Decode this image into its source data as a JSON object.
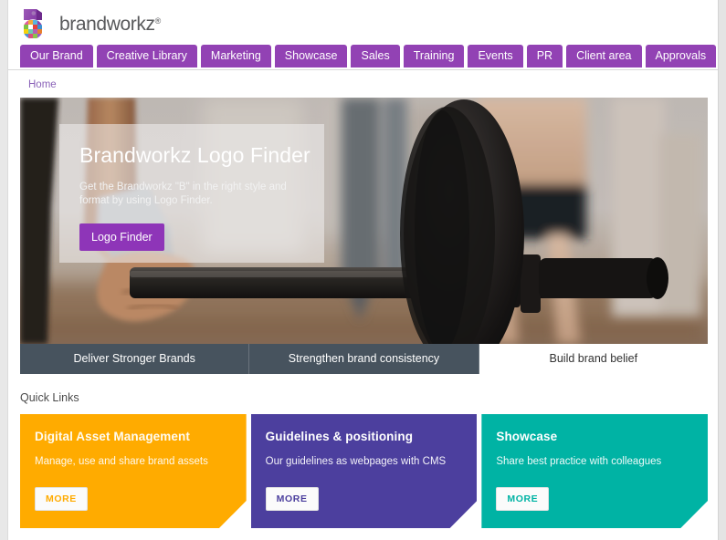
{
  "brand": {
    "logo_icon": "brandworkz-cube-logo-icon",
    "wordmark": "brandworkz",
    "registered_mark": "®",
    "primary_purple": "#9242b4",
    "logo_text_color": "#58595b"
  },
  "nav": {
    "items": [
      {
        "label": "Our Brand"
      },
      {
        "label": "Creative Library"
      },
      {
        "label": "Marketing"
      },
      {
        "label": "Showcase"
      },
      {
        "label": "Sales"
      },
      {
        "label": "Training"
      },
      {
        "label": "Events"
      },
      {
        "label": "PR"
      },
      {
        "label": "Client area"
      },
      {
        "label": "Approvals"
      }
    ]
  },
  "breadcrumb": {
    "items": [
      {
        "label": "Home"
      }
    ]
  },
  "hero": {
    "title": "Brandworkz Logo Finder",
    "subtitle": "Get the Brandworkz \"B\" in the right style and format by using Logo Finder.",
    "button_label": "Logo Finder",
    "button_color": "#8e35b8",
    "image_description": "gym-barbell-photo"
  },
  "hero_tabs": {
    "items": [
      {
        "label": "Deliver Stronger Brands",
        "active": false
      },
      {
        "label": "Strengthen brand consistency",
        "active": false
      },
      {
        "label": "Build brand belief",
        "active": true
      }
    ],
    "inactive_color": "#47535e",
    "active_color": "#ffffff"
  },
  "quick_links": {
    "heading": "Quick Links",
    "cards": [
      {
        "title": "Digital Asset Management",
        "description": "Manage, use and share brand assets",
        "more_label": "MORE",
        "color": "#ffab00"
      },
      {
        "title": "Guidelines & positioning",
        "description": "Our guidelines as webpages with CMS",
        "more_label": "MORE",
        "color": "#4c3f9e"
      },
      {
        "title": "Showcase",
        "description": "Share best practice with colleagues",
        "more_label": "MORE",
        "color": "#00b3a4"
      }
    ]
  }
}
